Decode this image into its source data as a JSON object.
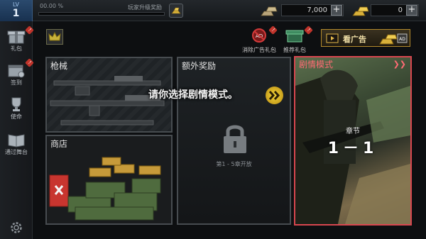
{
  "top_bar": {
    "level_label": "LV",
    "level": "1",
    "xp_percent_text": "00.00 %",
    "xp_progress": 0.0,
    "upgrade_reward_label": "玩家升级奖励",
    "currency_gold": "7,000",
    "currency_cash": "0"
  },
  "sidebar": {
    "items": [
      {
        "label": "礼包",
        "badge": "!"
      },
      {
        "label": "签到",
        "badge": "!"
      },
      {
        "label": "使命",
        "badge": ""
      },
      {
        "label": "通过舞台",
        "badge": ""
      }
    ]
  },
  "promos": {
    "remove_ads_label": "消除广告礼包",
    "recommended_label": "推荐礼包",
    "watch_ad_label": "看广告",
    "ad_text": "AD"
  },
  "panels": {
    "guns_title": "枪械",
    "shop_title": "商店",
    "bonus_title": "额外奖励",
    "bonus_lock_text": "第1 - 5章开放",
    "story_title": "剧情模式",
    "story_chapter_label": "章节",
    "story_level": "1－1"
  },
  "prompt_text": "请你选择剧情模式。",
  "colors": {
    "accent_gold": "#c9a227",
    "story_border": "#d8464f",
    "badge_red": "#c0342b"
  }
}
